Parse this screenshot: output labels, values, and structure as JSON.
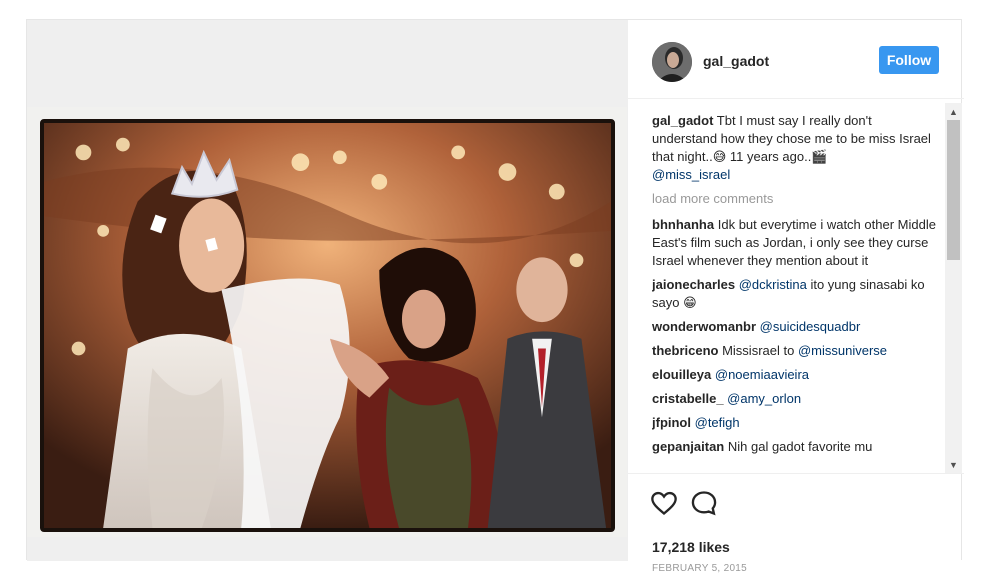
{
  "post": {
    "author": {
      "username": "gal_gadot",
      "avatar_icon": "profile-avatar"
    },
    "follow_label": "Follow",
    "caption": {
      "username": "gal_gadot",
      "text": "Tbt I must say I really don't understand how they chose me to be miss Israel that night..",
      "emoji1": "😅",
      "text2": " 11 years ago..",
      "emoji2": "🎬",
      "mention": "@miss_israel"
    },
    "load_more": "load more comments",
    "comments": [
      {
        "user": "bhnhanha",
        "text": "Idk but everytime i watch other Middle East's film such as Jordan, i only see they curse Israel whenever they mention about it",
        "mention": ""
      },
      {
        "user": "jaionecharles",
        "mention": "@dckristina",
        "text": " ito yung sinasabi ko sayo 😁"
      },
      {
        "user": "wonderwomanbr",
        "mention": "@suicidesquadbr",
        "text": ""
      },
      {
        "user": "thebriceno",
        "text": "Missisrael to ",
        "mention": "@missuniverse"
      },
      {
        "user": "elouilleya",
        "mention": "@noemiaavieira",
        "text": ""
      },
      {
        "user": "cristabelle_",
        "mention": "@amy_orlon",
        "text": ""
      },
      {
        "user": "jfpinol",
        "mention": "@tefigh",
        "text": ""
      },
      {
        "user": "gepanjaitan",
        "text": "Nih gal gadot favorite mu",
        "mention": ""
      }
    ],
    "likes": "17,218 likes",
    "date": "FEBRUARY 5, 2015",
    "colors": {
      "accent": "#3897f0",
      "mention": "#003569",
      "muted": "#999999"
    }
  }
}
